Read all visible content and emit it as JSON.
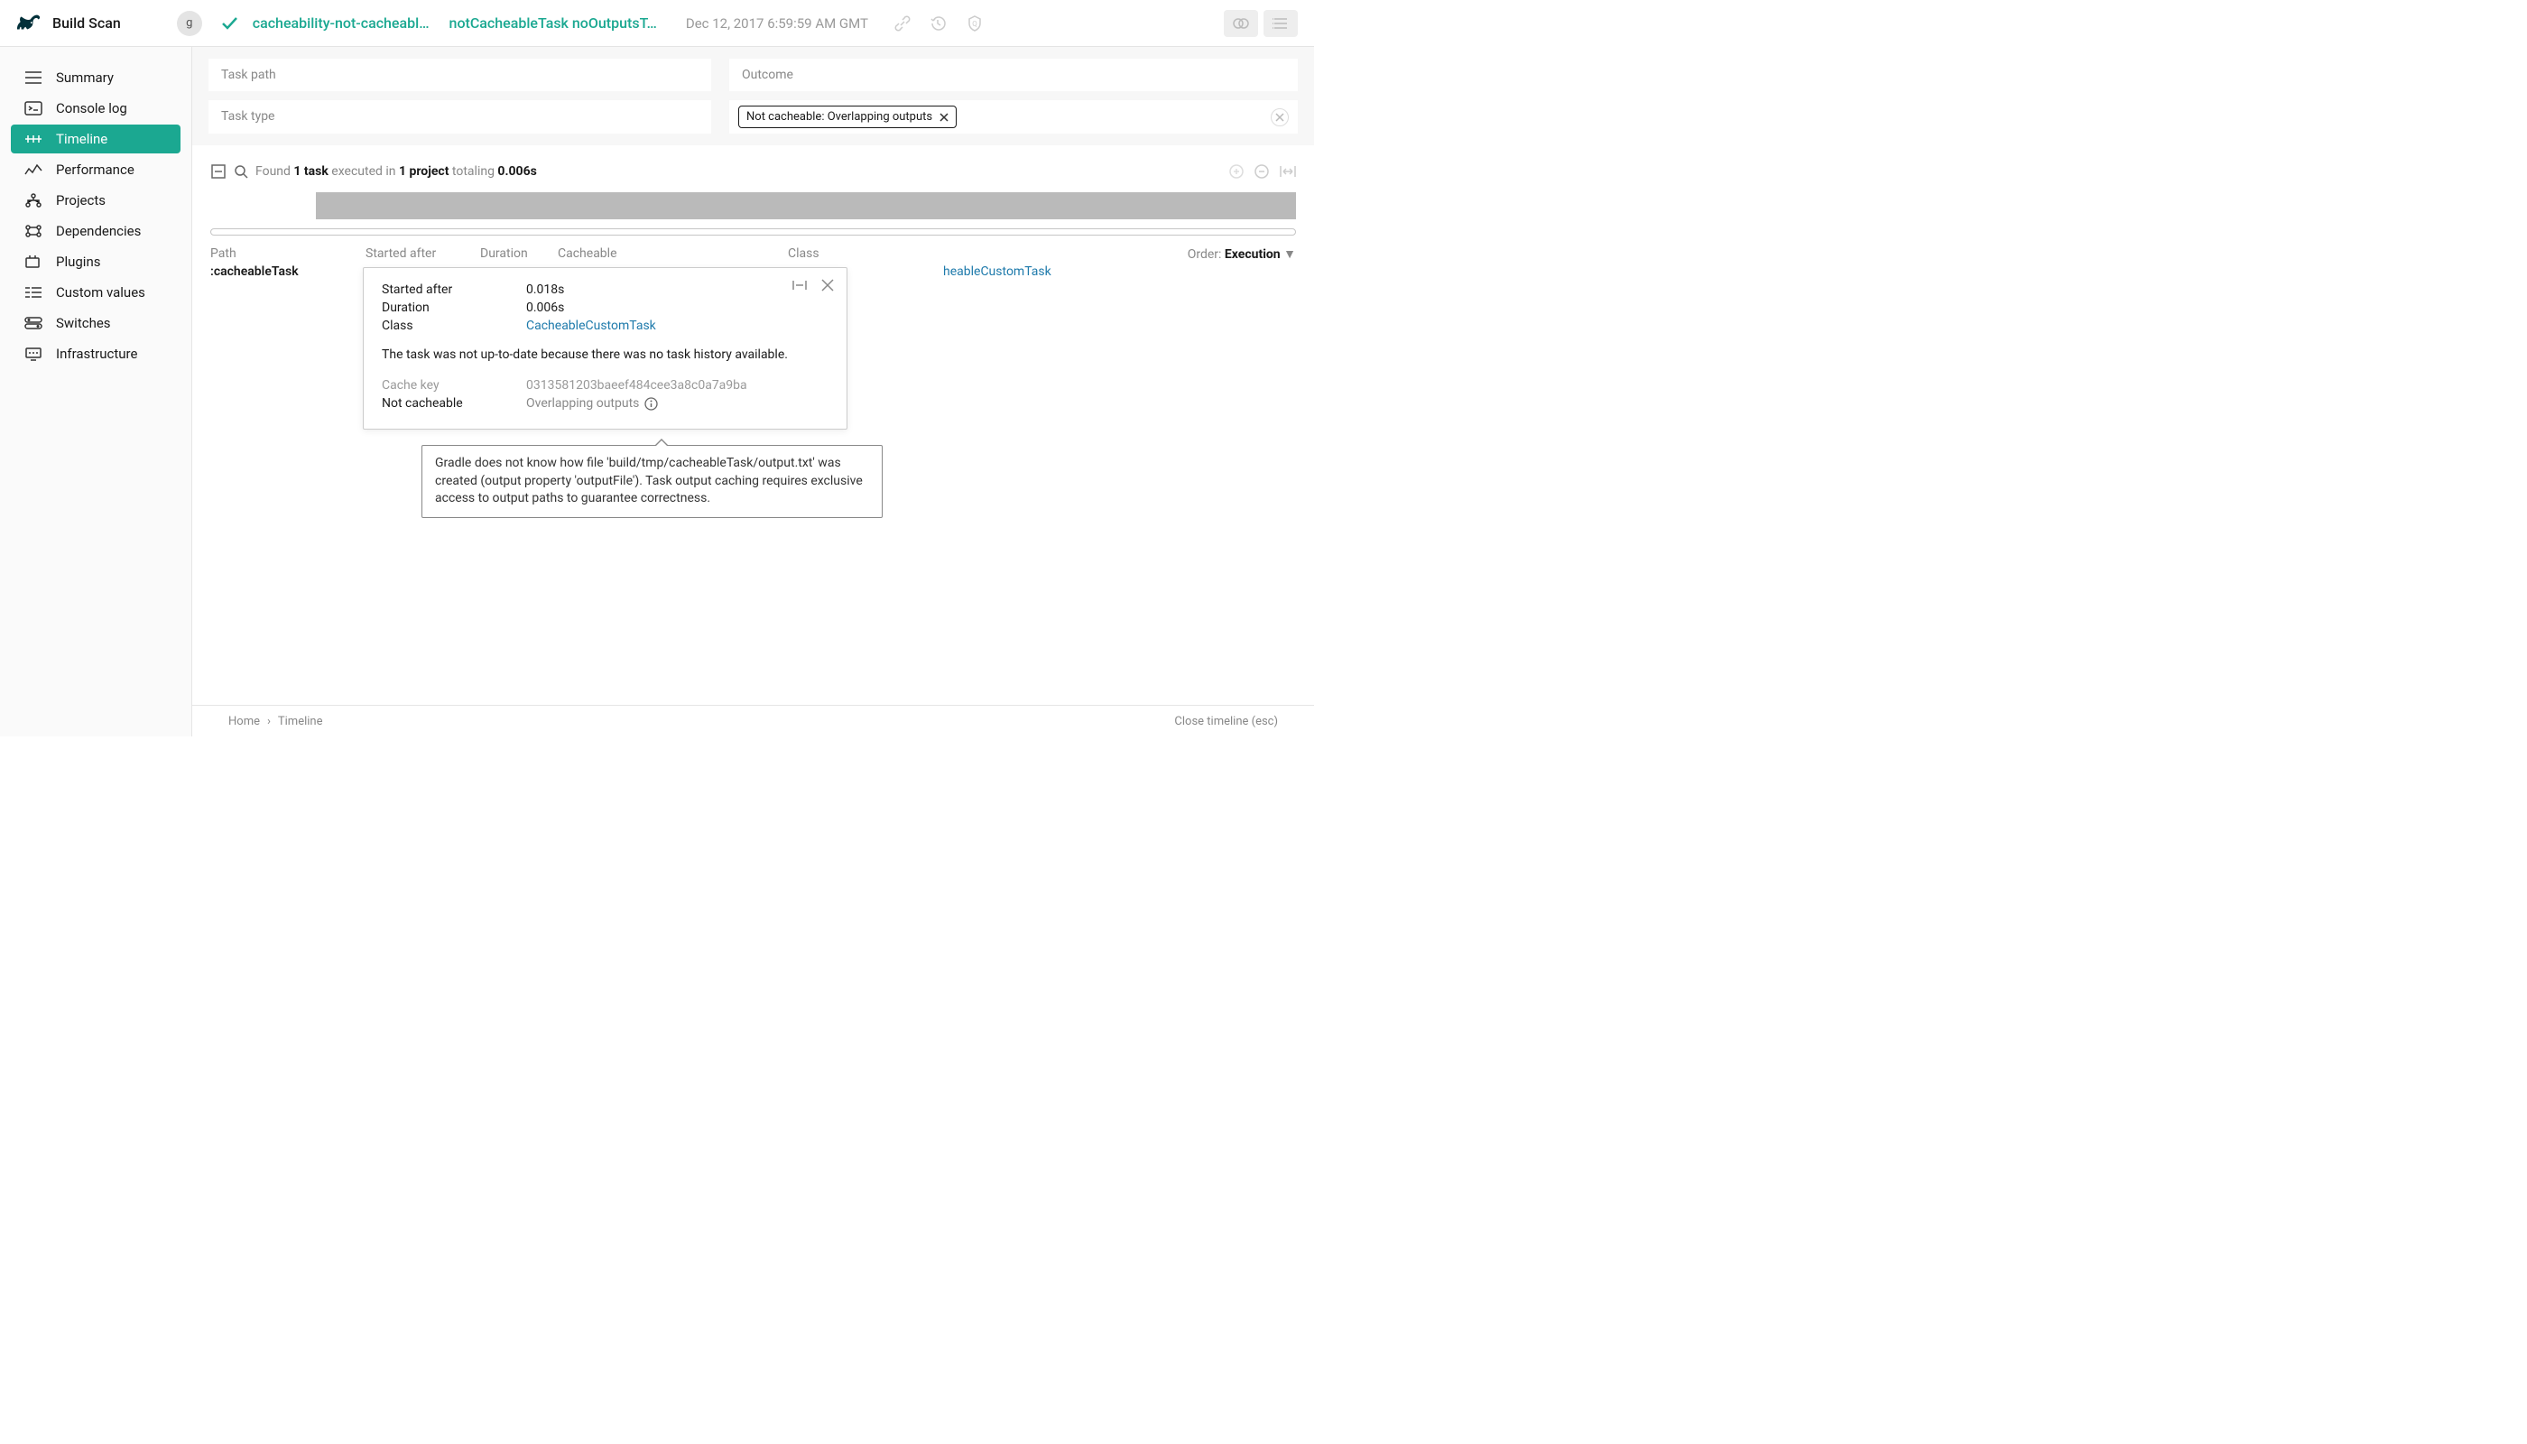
{
  "header": {
    "brand": "Build Scan",
    "user_initial": "g",
    "build_name": "cacheability-not-cacheabl…",
    "tasks_string": "notCacheableTask noOutputsT…",
    "timestamp": "Dec 12, 2017 6:59:59 AM GMT"
  },
  "sidebar": {
    "items": [
      {
        "label": "Summary"
      },
      {
        "label": "Console log"
      },
      {
        "label": "Timeline"
      },
      {
        "label": "Performance"
      },
      {
        "label": "Projects"
      },
      {
        "label": "Dependencies"
      },
      {
        "label": "Plugins"
      },
      {
        "label": "Custom values"
      },
      {
        "label": "Switches"
      },
      {
        "label": "Infrastructure"
      }
    ]
  },
  "filters": {
    "task_path_label": "Task path",
    "task_type_label": "Task type",
    "outcome_label": "Outcome",
    "chip_text": "Not cacheable: Overlapping outputs"
  },
  "summary": {
    "prefix": "Found ",
    "count": "1 task",
    "mid1": " executed in ",
    "projects": "1 project",
    "mid2": " totaling ",
    "duration": "0.006s"
  },
  "columns": {
    "path": "Path",
    "started": "Started after",
    "duration": "Duration",
    "cacheable": "Cacheable",
    "class": "Class",
    "order_label": "Order: ",
    "order_value": "Execution"
  },
  "task": {
    "name": ":cacheableTask",
    "class_peek": "heableCustomTask"
  },
  "popover": {
    "started_label": "Started after",
    "started_value": "0.018s",
    "duration_label": "Duration",
    "duration_value": "0.006s",
    "class_label": "Class",
    "class_value": "CacheableCustomTask",
    "message": "The task was not up-to-date because there was no task history available.",
    "cache_key_label": "Cache key",
    "cache_key_value": "0313581203baeef484cee3a8c0a7a9ba",
    "not_cacheable_label": "Not cacheable",
    "not_cacheable_value": "Overlapping outputs"
  },
  "tooltip": {
    "text": "Gradle does not know how file 'build/tmp/cacheableTask/output.txt' was created (output property 'outputFile'). Task output caching requires exclusive access to output paths to guarantee correctness."
  },
  "footer": {
    "home": "Home",
    "separator": "›",
    "current": "Timeline",
    "close": "Close timeline (esc)"
  }
}
